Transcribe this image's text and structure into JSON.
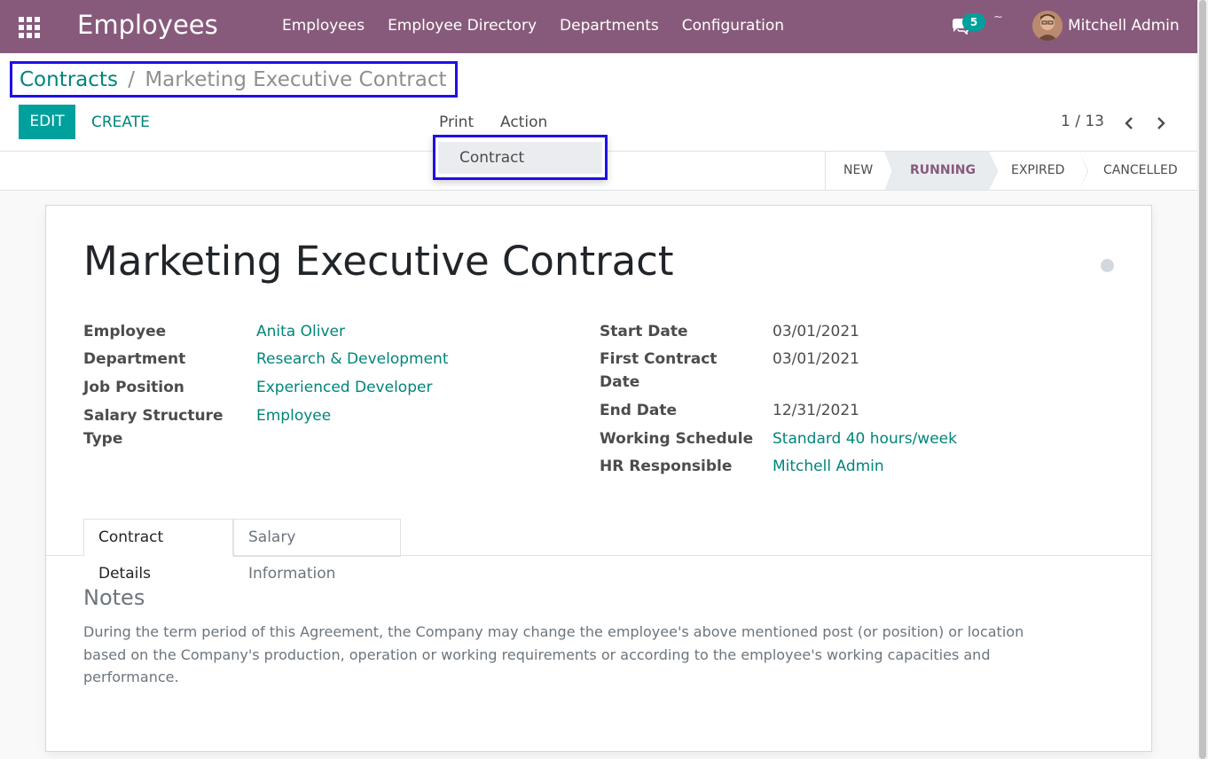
{
  "navbar": {
    "app_title": "Employees",
    "menu": [
      "Employees",
      "Employee Directory",
      "Departments",
      "Configuration"
    ],
    "chat_count": "5",
    "tilde": "~",
    "user_name": "Mitchell Admin",
    "bg_color": "#875a7b"
  },
  "breadcrumb": {
    "parent": "Contracts",
    "separator": "/",
    "current": "Marketing Executive Contract"
  },
  "toolbar": {
    "edit_label": "EDIT",
    "create_label": "CREATE",
    "print_label": "Print",
    "action_label": "Action",
    "pager": "1 / 13"
  },
  "print_menu": {
    "items": [
      "Contract"
    ]
  },
  "stages": {
    "items": [
      "NEW",
      "RUNNING",
      "EXPIRED",
      "CANCELLED"
    ],
    "active": "RUNNING"
  },
  "record": {
    "title": "Marketing Executive Contract",
    "left_fields": [
      {
        "label": "Employee",
        "value": "Anita Oliver"
      },
      {
        "label": "Department",
        "value": "Research & Development"
      },
      {
        "label": "Job Position",
        "value": "Experienced Developer"
      },
      {
        "label": "Salary Structure Type",
        "value": "Employee"
      }
    ],
    "right_fields": [
      {
        "label": "Start Date",
        "value": "03/01/2021"
      },
      {
        "label": "First Contract Date",
        "value": "03/01/2021"
      },
      {
        "label": "End Date",
        "value": "12/31/2021"
      },
      {
        "label": "Working Schedule",
        "value": "Standard 40 hours/week"
      },
      {
        "label": "HR Responsible",
        "value": "Mitchell Admin"
      }
    ]
  },
  "tabs": [
    "Contract Details",
    "Salary Information"
  ],
  "notes": {
    "heading": "Notes",
    "text": "During the term period of this Agreement, the Company may change the employee's above mentioned post (or position) or location based on the Company's production, operation or working requirements or according to the employee's working capacities and performance."
  },
  "colors": {
    "accent": "#00a09d",
    "link": "#00857a",
    "highlight_border": "#1f10e6"
  }
}
